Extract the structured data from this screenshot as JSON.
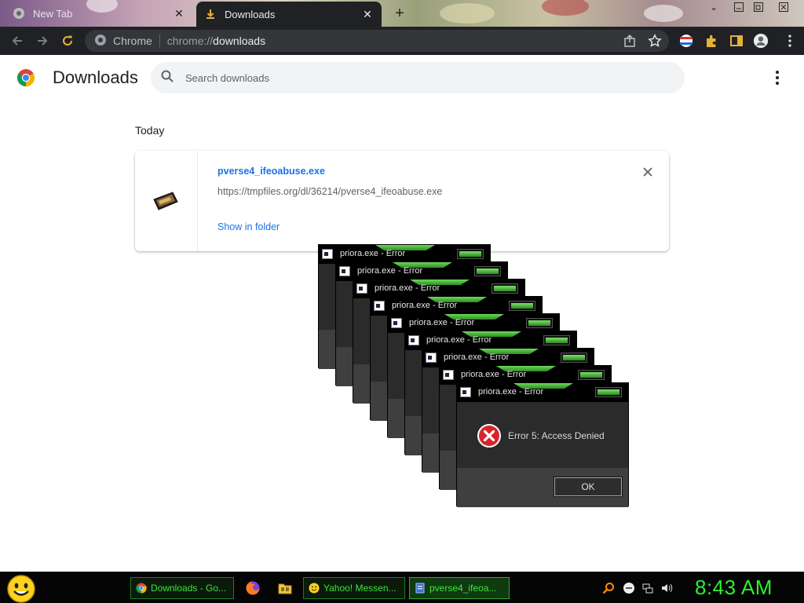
{
  "browser": {
    "tabs": [
      {
        "label": "New Tab",
        "active": false
      },
      {
        "label": "Downloads",
        "active": true
      }
    ],
    "omnibox": {
      "site_label": "Chrome",
      "url_scheme": "chrome://",
      "url_host": "downloads"
    }
  },
  "page": {
    "title": "Downloads",
    "search_placeholder": "Search downloads",
    "section_date": "Today",
    "download": {
      "filename": "pverse4_ifeoabuse.exe",
      "url": "https://tmpfiles.org/dl/36214/pverse4_ifeoabuse.exe",
      "action_label": "Show in folder"
    }
  },
  "dialogs": {
    "title": "priora.exe - Error",
    "message": "Error 5: Access Denied",
    "ok_label": "OK",
    "count": 9
  },
  "taskbar": {
    "buttons": [
      {
        "label": "Downloads - Go...",
        "icon": "chrome-icon"
      },
      {
        "label": "Yahoo! Messen...",
        "icon": "yahoo-messenger-icon"
      },
      {
        "label": "pverse4_ifeoa...",
        "icon": "exe-file-icon"
      }
    ],
    "clock": "8:43 AM"
  },
  "colors": {
    "accent_blue": "#1a73e8",
    "toolbar_bg": "#202124",
    "taskbar_green": "#2cf02c",
    "dialog_bg": "#2b2b2b"
  }
}
